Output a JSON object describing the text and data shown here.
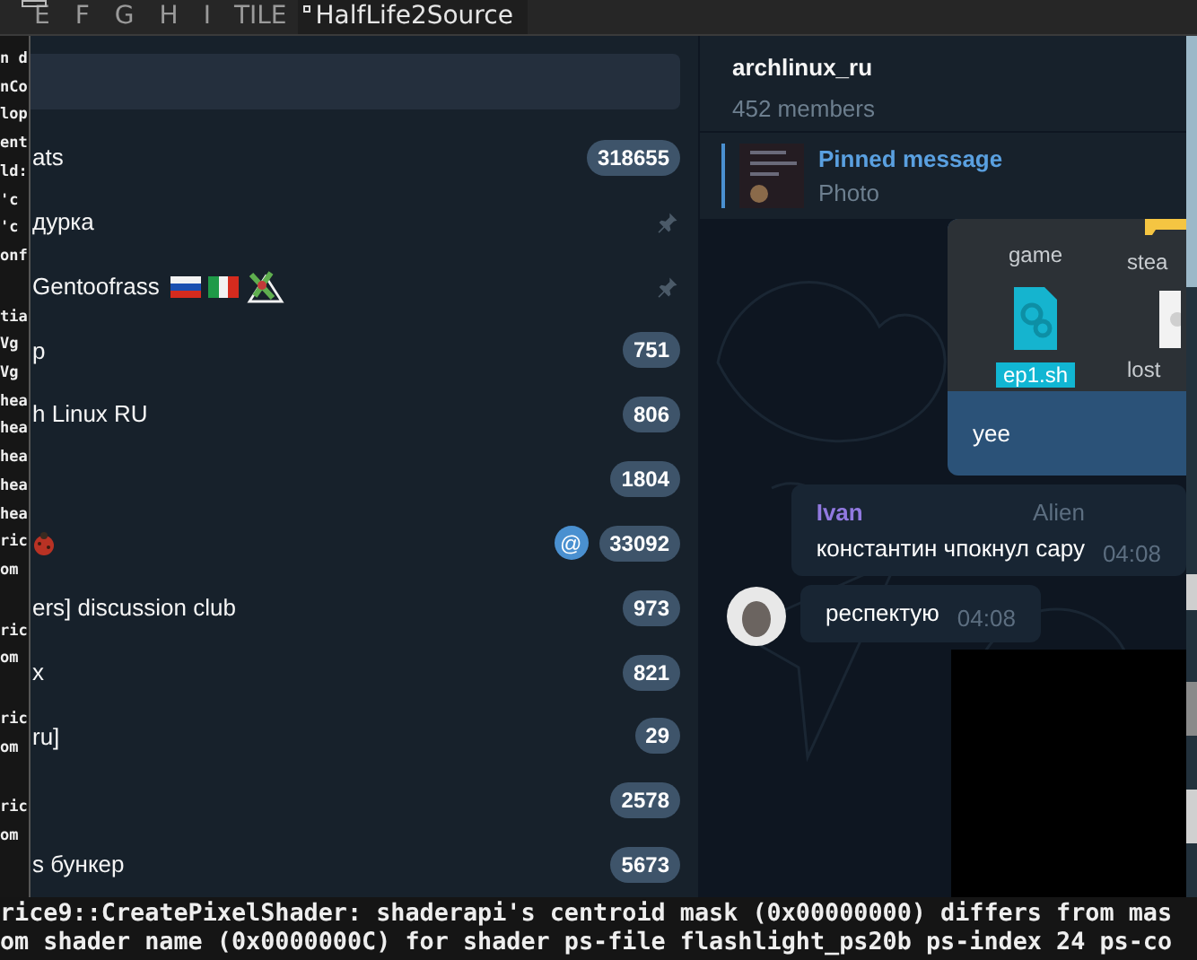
{
  "bar": {
    "tags": [
      {
        "label": "E",
        "selected": false,
        "occupied": true
      },
      {
        "label": "F",
        "selected": false,
        "occupied": false
      },
      {
        "label": "G",
        "selected": false,
        "occupied": false
      },
      {
        "label": "H",
        "selected": false,
        "occupied": false
      },
      {
        "label": "I",
        "selected": false,
        "occupied": false
      }
    ],
    "layout": "TILE",
    "title": "HalfLife2Source"
  },
  "terminal_side": {
    "blocks": [
      [
        "n d",
        "nCo",
        "lop",
        "ent",
        "ld:",
        "'c",
        "'c",
        "onf"
      ],
      [
        "tia",
        "Vg",
        "Vg",
        "hea",
        "hea",
        "hea",
        "hea",
        "hea",
        "ric",
        "om"
      ],
      [
        "ric",
        "om"
      ],
      [
        "ric",
        "om"
      ],
      [
        "ric",
        "om"
      ]
    ]
  },
  "chats": [
    {
      "name": "ats",
      "kind": "plain",
      "unread": "318655",
      "pinned": false
    },
    {
      "name": "дурка",
      "kind": "plain",
      "pinned": true
    },
    {
      "name": "Gentoofrass",
      "kind": "flags",
      "pinned": true
    },
    {
      "name": "p",
      "kind": "plain",
      "unread": "751",
      "pinned": false
    },
    {
      "name": "h Linux RU",
      "kind": "plain",
      "unread": "806",
      "pinned": false
    },
    {
      "kind": "plain",
      "unread": "1804",
      "pinned": false
    },
    {
      "kind": "bug",
      "unread": "33092",
      "pinned": false,
      "mention_badge": "@"
    },
    {
      "name": "ers] discussion club",
      "kind": "plain",
      "unread": "973",
      "pinned": false
    },
    {
      "name": "x",
      "kind": "plain",
      "unread": "821",
      "pinned": false
    },
    {
      "name": "ru]",
      "kind": "plain",
      "unread": "29",
      "pinned": false
    },
    {
      "kind": "plain",
      "unread": "2578",
      "pinned": false
    },
    {
      "name": "s бункер",
      "kind": "plain",
      "unread": "5673",
      "pinned": false
    }
  ],
  "chat": {
    "title": "archlinux_ru",
    "subtitle": "452 members",
    "pinned": {
      "label": "Pinned message",
      "text": "Photo"
    },
    "photo_files": [
      {
        "label": "game",
        "kind": "folder",
        "selected": false
      },
      {
        "label": "stea",
        "kind": "folder",
        "selected": false
      },
      {
        "label": "ep1.sh",
        "kind": "script",
        "selected": true
      },
      {
        "label": "lost",
        "kind": "document",
        "selected": false
      }
    ],
    "messages": [
      {
        "kind": "outgoing",
        "text": "yee"
      },
      {
        "kind": "incoming",
        "sender": "Ivan",
        "badge": "Alien",
        "text": "константин чпокнул сару",
        "time": "04:08",
        "avatar": false
      },
      {
        "kind": "incoming",
        "text": "респектую",
        "time": "04:08",
        "avatar": true
      }
    ]
  },
  "terminal_bottom": [
    "rice9::CreatePixelShader: shaderapi's centroid mask (0x00000000) differs from mas",
    "om shader name (0x0000000C) for shader ps-file flashlight_ps20b ps-index 24 ps-co"
  ]
}
